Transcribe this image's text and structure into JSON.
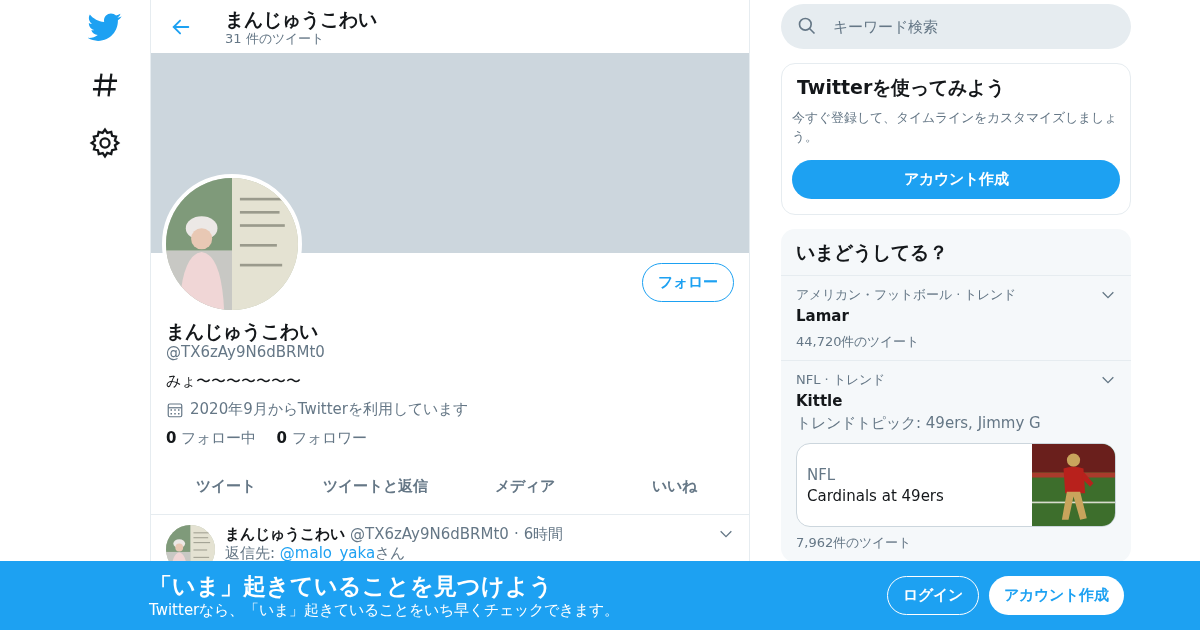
{
  "header": {
    "title": "まんじゅうこわい",
    "subtitle": "31 件のツイート"
  },
  "profile": {
    "name": "まんじゅうこわい",
    "handle": "@TX6zAy9N6dBRMt0",
    "bio": "みょ〜〜〜〜〜〜〜",
    "joined": "2020年9月からTwitterを利用しています",
    "following_count": "0",
    "following_label": "フォロー中",
    "followers_count": "0",
    "followers_label": "フォロワー",
    "follow_button": "フォロー"
  },
  "tabs": [
    {
      "label": "ツイート",
      "selected": false
    },
    {
      "label": "ツイートと返信",
      "selected": false
    },
    {
      "label": "メディア",
      "selected": false
    },
    {
      "label": "いいね",
      "selected": false
    }
  ],
  "tweet": {
    "name": "まんじゅうこわい",
    "handle": "@TX6zAy9N6dBRMt0",
    "separator": "·",
    "time": "6時間",
    "reply_prefix": "返信先: ",
    "reply_mention": "@malo_yaka",
    "reply_suffix": "さん"
  },
  "search": {
    "placeholder": "キーワード検索"
  },
  "signup_card": {
    "title": "Twitterを使ってみよう",
    "text": "今すぐ登録して、タイムラインをカスタマイズしましょう。",
    "button": "アカウント作成"
  },
  "trends": {
    "title": "いまどうしてる？",
    "items": [
      {
        "context": "アメリカン・フットボール · トレンド",
        "name": "Lamar",
        "count": "44,720件のツイート"
      },
      {
        "context": "NFL · トレンド",
        "name": "Kittle",
        "topics": "トレンドトピック: 49ers, Jimmy G",
        "card": {
          "source": "NFL",
          "title": "Cardinals at 49ers"
        },
        "count": "7,962件のツイート"
      }
    ]
  },
  "bottom_bar": {
    "title": "「いま」起きていることを見つけよう",
    "subtitle": "Twitterなら、「いま」起きていることをいち早くチェックできます。",
    "login": "ログイン",
    "signup": "アカウント作成"
  }
}
